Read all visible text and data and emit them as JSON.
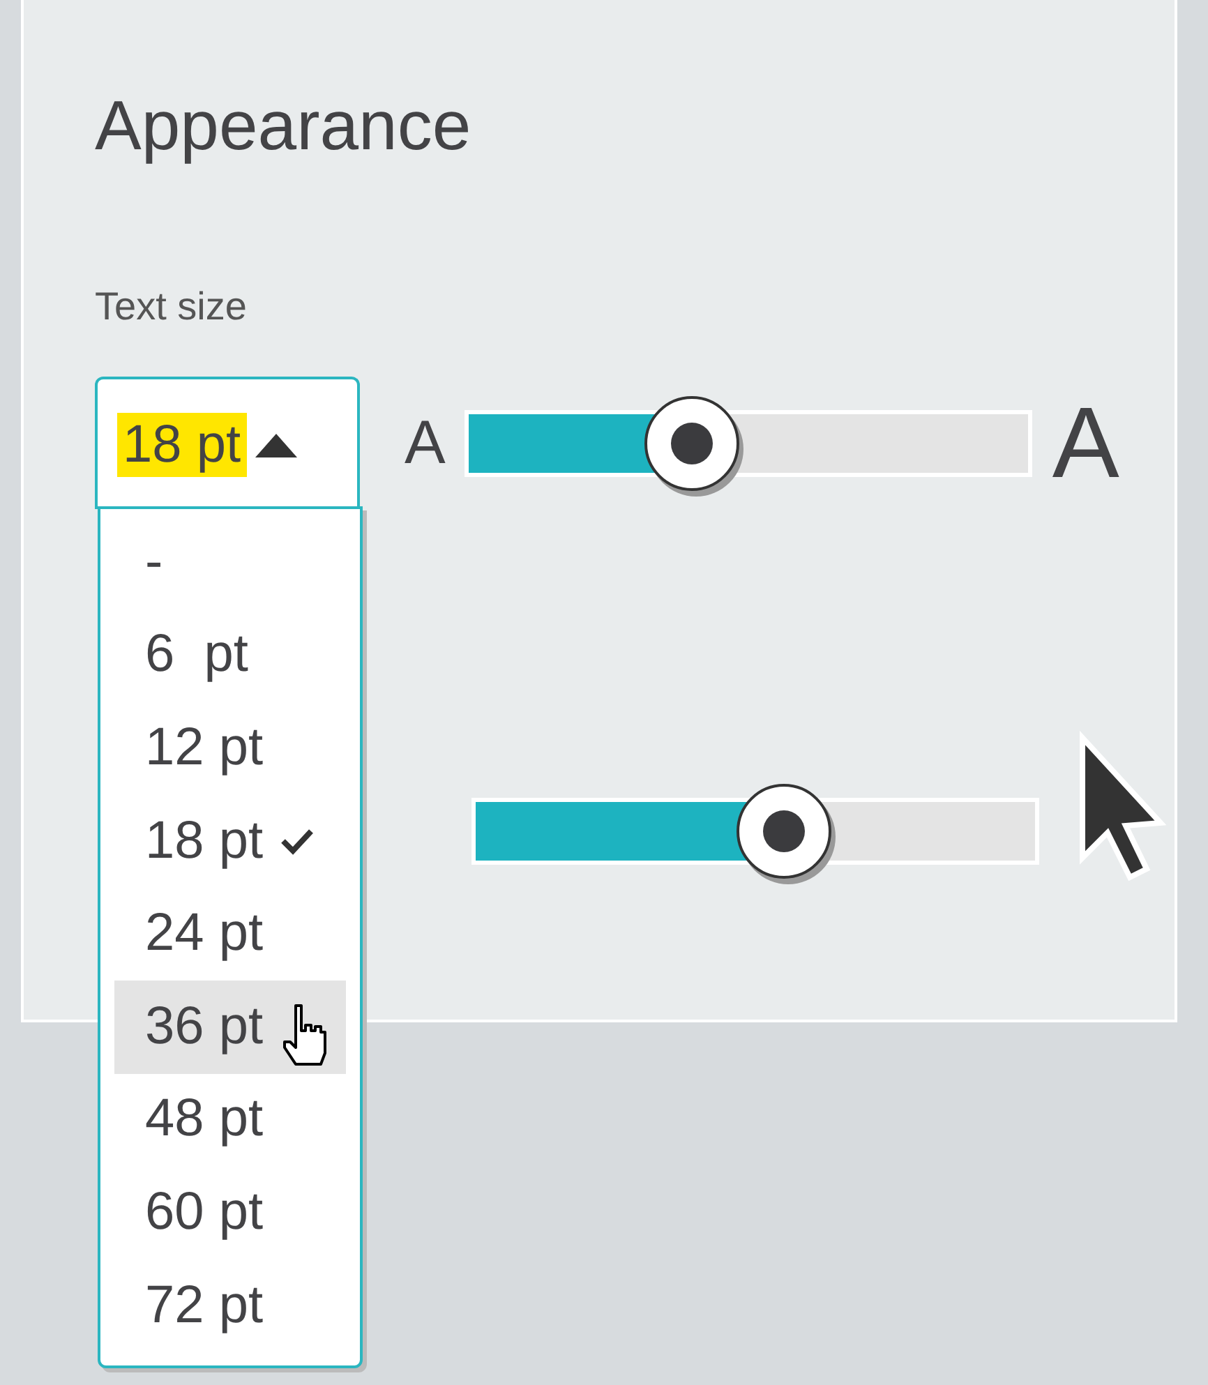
{
  "panel": {
    "title": "Appearance",
    "setting_label": "Text size"
  },
  "dropdown": {
    "value": "18 pt",
    "expanded": true,
    "options": [
      {
        "label": "-",
        "selected": false,
        "hovered": false
      },
      {
        "label": "6  pt",
        "selected": false,
        "hovered": false
      },
      {
        "label": "12 pt",
        "selected": false,
        "hovered": false
      },
      {
        "label": "18 pt",
        "selected": true,
        "hovered": false
      },
      {
        "label": "24 pt",
        "selected": false,
        "hovered": false
      },
      {
        "label": "36 pt",
        "selected": false,
        "hovered": true
      },
      {
        "label": "48 pt",
        "selected": false,
        "hovered": false
      },
      {
        "label": "60 pt",
        "selected": false,
        "hovered": false
      },
      {
        "label": "72 pt",
        "selected": false,
        "hovered": false
      }
    ]
  },
  "sliders": [
    {
      "min_label": "A",
      "max_label": "A",
      "level": 0.4
    },
    {
      "level": 0.55
    }
  ]
}
